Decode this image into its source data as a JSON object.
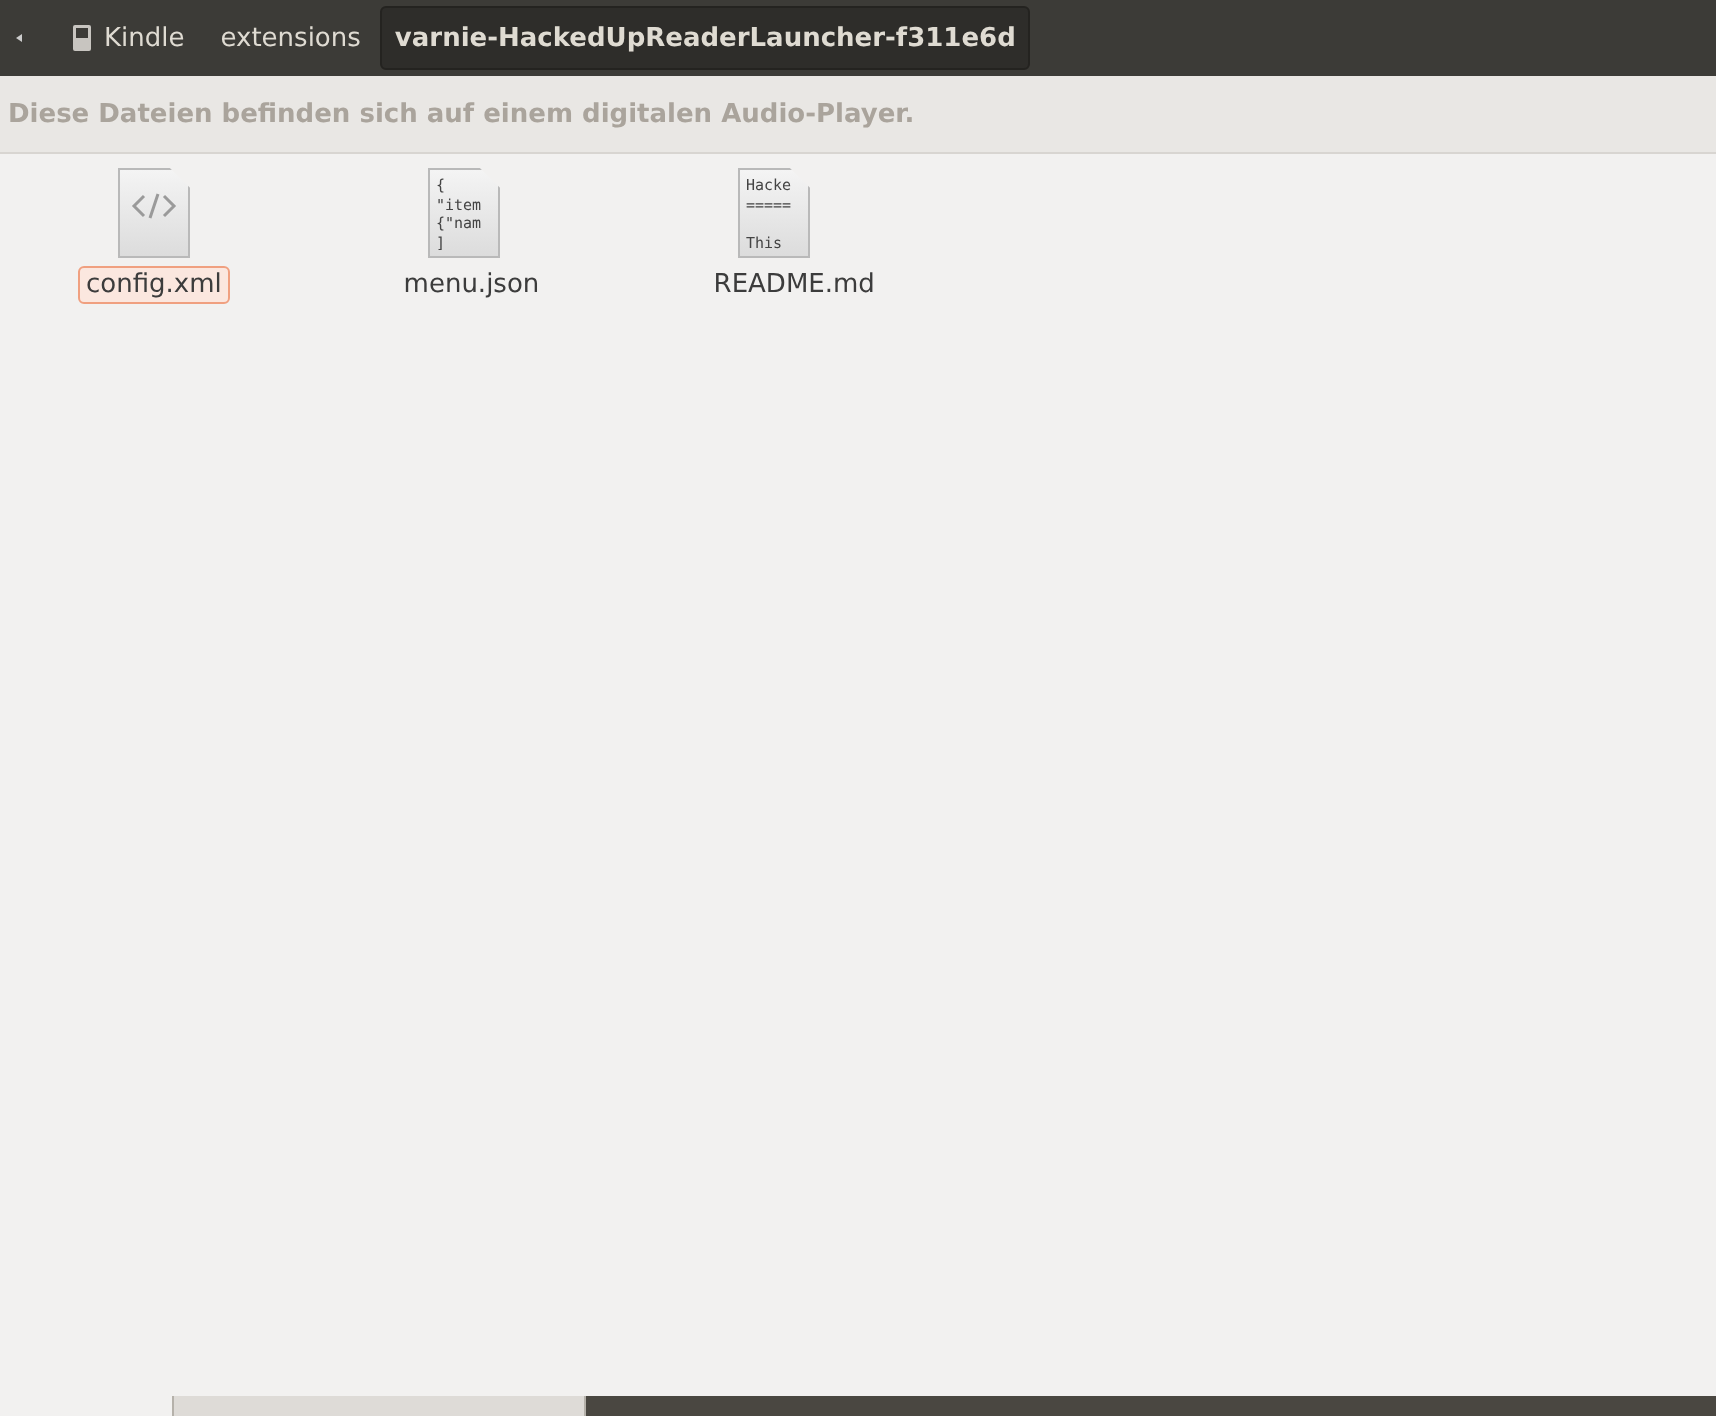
{
  "path_bar": {
    "crumbs": [
      {
        "label": "Kindle",
        "kind": "device",
        "selected": false
      },
      {
        "label": "extensions",
        "kind": "folder",
        "selected": false
      },
      {
        "label": "varnie-HackedUpReaderLauncher-f311e6d",
        "kind": "folder",
        "selected": true
      }
    ]
  },
  "info_bar": {
    "message": "Diese Dateien befinden sich auf einem digitalen Audio-Player."
  },
  "files": [
    {
      "name": "config.xml",
      "kind": "code",
      "selected": true
    },
    {
      "name": "menu.json",
      "kind": "text",
      "selected": false,
      "preview": [
        {
          "text": "{"
        },
        {
          "text": "\"item"
        },
        {
          "text": "{\"nam"
        },
        {
          "text": "]"
        }
      ]
    },
    {
      "name": "README.md",
      "kind": "text",
      "selected": false,
      "preview": [
        {
          "text": "Hacke"
        },
        {
          "text": "====="
        },
        {
          "text": "This",
          "blank_line_before": true
        }
      ]
    }
  ]
}
